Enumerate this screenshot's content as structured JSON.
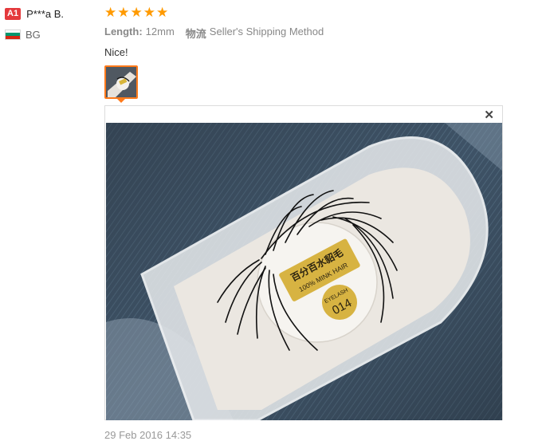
{
  "reviewer": {
    "level_badge": "A1",
    "name": "P***a B.",
    "country": "BG",
    "flag_colors": [
      "#ffffff",
      "#00966e",
      "#d62612"
    ]
  },
  "review": {
    "rating": 5,
    "stars": [
      "★",
      "★",
      "★",
      "★",
      "★"
    ],
    "star_color": "#ff9a00",
    "length_label": "Length:",
    "length_value": "12mm",
    "shipping_label": "物流",
    "shipping_value": "Seller's Shipping Method",
    "text": "Nice!",
    "date": "29 Feb 2016 14:35"
  },
  "photo": {
    "close_icon": "close-icon",
    "label_cn": "百分百水貂毛",
    "label_en": "100% MINK HAIR",
    "sticker_brand": "EYELASH",
    "sticker_number": "014"
  }
}
